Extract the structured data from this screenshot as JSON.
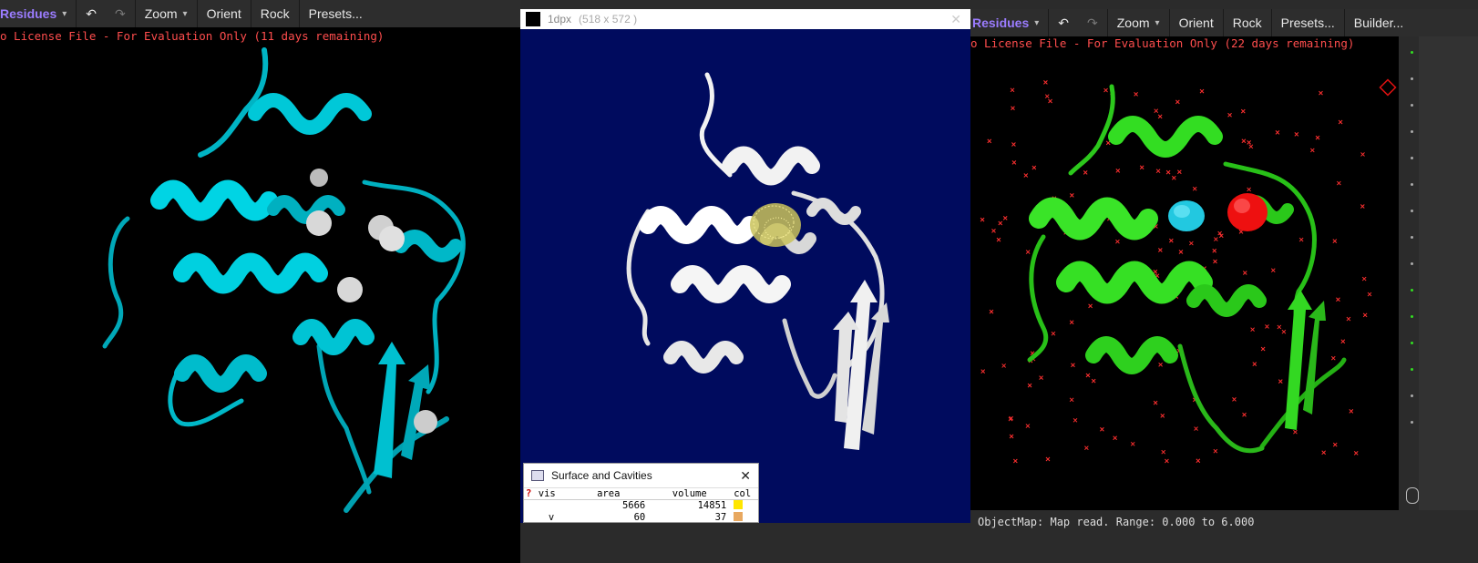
{
  "left_pymol": {
    "toolbar": {
      "residues": "Residues",
      "zoom": "Zoom",
      "orient": "Orient",
      "rock": "Rock",
      "presets": "Presets..."
    },
    "license_text": "o License File - For Evaluation Only (11 days remaining)"
  },
  "middle_window": {
    "title": "1dpx",
    "size": "(518 x 572 )",
    "dialog": {
      "title": "Surface and Cavities",
      "columns": [
        "vis",
        "area",
        "volume",
        "col"
      ],
      "rows": [
        {
          "vis": "",
          "area": "5666",
          "volume": "14851",
          "color": "#ffe600"
        },
        {
          "vis": "v",
          "area": "60",
          "volume": "37",
          "color": "#e8a860"
        }
      ]
    }
  },
  "right_pymol": {
    "toolbar": {
      "residues": "Residues",
      "zoom": "Zoom",
      "orient": "Orient",
      "rock": "Rock",
      "presets": "Presets...",
      "builder": "Builder..."
    },
    "license_text": "o License File - For Evaluation Only (22 days remaining)",
    "status_text": "ObjectMap: Map read.  Range: 0.000 to 6.000"
  },
  "colors": {
    "cyan_ribbon": "#00c8d8",
    "white_ribbon": "#f2f2f2",
    "green_ribbon": "#33dd22",
    "navy_bg": "#000b5e",
    "license_red": "#ff4d4d"
  }
}
